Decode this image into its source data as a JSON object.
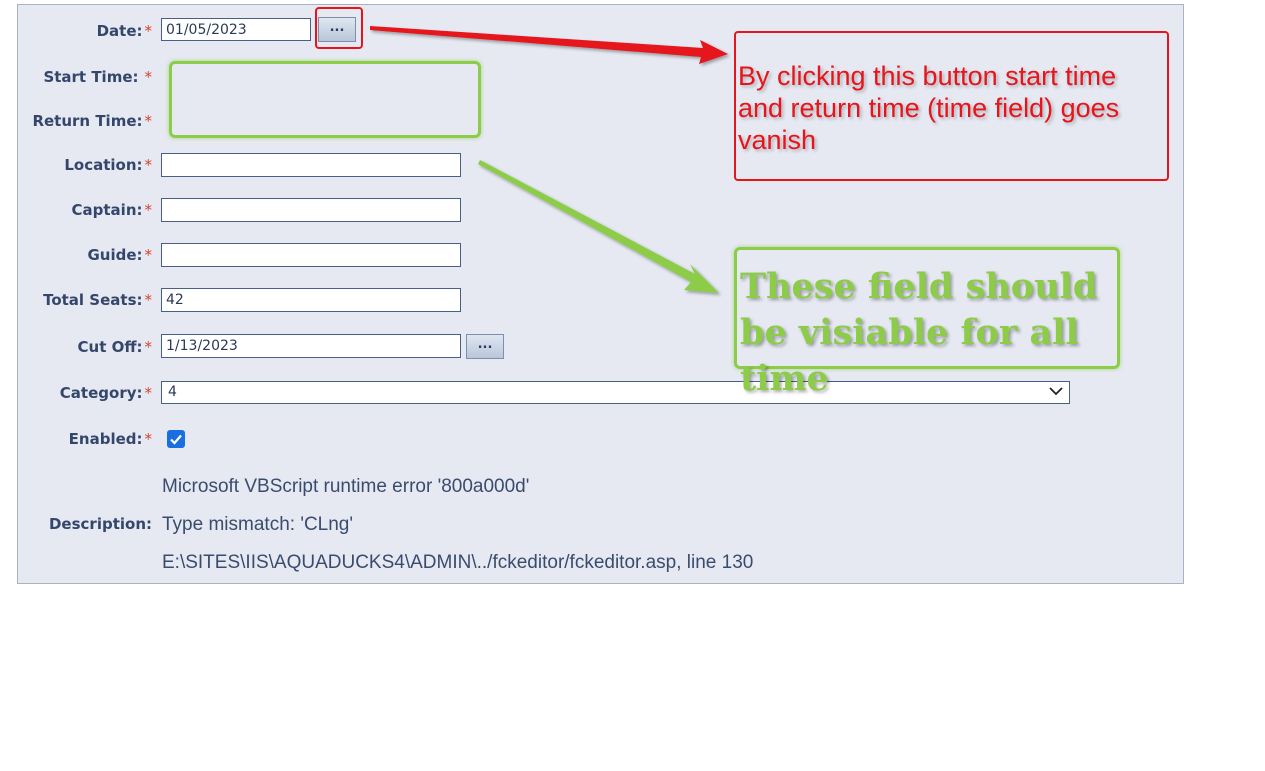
{
  "form": {
    "date": {
      "label": "Date:",
      "value": "01/05/2023",
      "button": "..."
    },
    "start_time": {
      "label": "Start Time:"
    },
    "return_time": {
      "label": "Return Time:"
    },
    "location": {
      "label": "Location:",
      "value": ""
    },
    "captain": {
      "label": "Captain:",
      "value": ""
    },
    "guide": {
      "label": "Guide:",
      "value": ""
    },
    "total_seats": {
      "label": "Total Seats:",
      "value": "42"
    },
    "cut_off": {
      "label": "Cut Off:",
      "value": "1/13/2023",
      "button": "..."
    },
    "category": {
      "label": "Category:",
      "value": "4"
    },
    "enabled": {
      "label": "Enabled:",
      "checked": true
    },
    "description": {
      "label": "Description:",
      "error_lines": [
        "Microsoft VBScript runtime error '800a000d'",
        "Type mismatch: 'CLng'",
        "E:\\SITES\\IIS\\AQUADUCKS4\\ADMIN\\../fckeditor/fckeditor.asp, line 130"
      ]
    },
    "required_marker": "*"
  },
  "annotations": {
    "red_note": "By clicking this button start time and return time (time field) goes vanish",
    "green_note": "These field should be visiable for all time",
    "red_color": "#e5151b",
    "green_color": "#8ccc48"
  },
  "icons": [
    "chevron-down-icon",
    "checkmark-icon",
    "arrow-icon"
  ]
}
